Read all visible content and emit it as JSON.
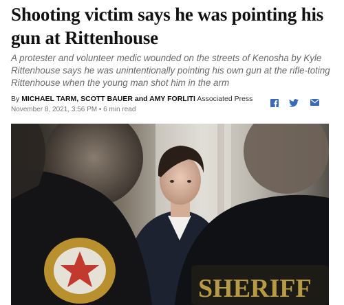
{
  "article": {
    "headline": "Shooting victim says he was pointing his gun at Rittenhouse",
    "dek": "A protester and volunteer medic wounded on the streets of Kenosha by Kyle Rittenhouse says he was unintentionally pointing his own gun at the rifle-toting Rittenhouse when the young man shot him in the arm",
    "byline_prefix": "By",
    "authors": "MICHAEL TARM, SCOTT BAUER and AMY FORLITI",
    "source": "Associated Press",
    "date": "November 8, 2021, 3:56 PM",
    "separator": "•",
    "read_time": "6 min read"
  },
  "share": {
    "facebook_icon": "facebook-icon",
    "twitter_icon": "twitter-icon",
    "email_icon": "email-icon",
    "color": "#3a6bb5"
  },
  "photo": {
    "patch_text": "SHERIFF"
  }
}
